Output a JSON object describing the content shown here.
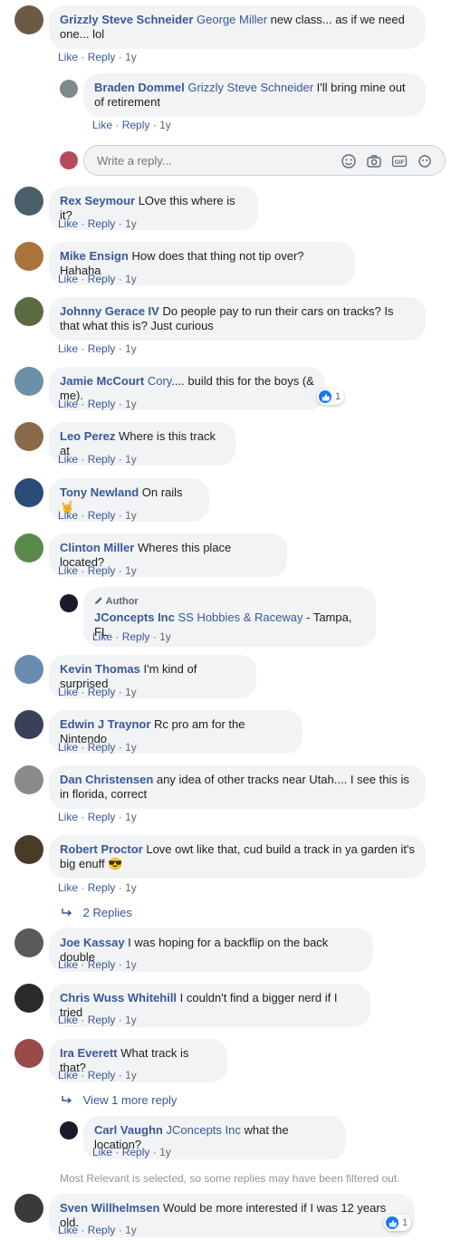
{
  "comments": [
    {
      "name": "Grizzly Steve Schneider",
      "tag": "George Miller",
      "text": " new class... as if we need one... lol",
      "meta": [
        "Like",
        "Reply",
        "1y"
      ]
    },
    {
      "name": "Braden Dommel",
      "tag": "Grizzly Steve Schneider",
      "text": " I'll bring mine out of retirement",
      "meta": [
        "Like",
        "Reply",
        "1y"
      ]
    },
    {
      "name": "Rex Seymour",
      "tag": "",
      "text": " LOve this where is it?",
      "meta": [
        "Like",
        "Reply",
        "1y"
      ]
    },
    {
      "name": "Mike Ensign",
      "tag": "",
      "text": " How does that thing not tip over? Hahaha",
      "meta": [
        "Like",
        "Reply",
        "1y"
      ]
    },
    {
      "name": "Johnny Gerace IV",
      "tag": "",
      "text": " Do people pay to run their cars on tracks? Is that what this is? Just curious",
      "meta": [
        "Like",
        "Reply",
        "1y"
      ]
    },
    {
      "name": "Jamie McCourt",
      "tag": "Cory",
      "text": ".... build this for the boys (& me).",
      "meta": [
        "Like",
        "Reply",
        "1y"
      ],
      "reactions": "1"
    },
    {
      "name": "Leo Perez",
      "tag": "",
      "text": " Where is this track at",
      "meta": [
        "Like",
        "Reply",
        "1y"
      ]
    },
    {
      "name": "Tony Newland",
      "tag": "",
      "text": " On rails 🤘",
      "meta": [
        "Like",
        "Reply",
        "1y"
      ]
    },
    {
      "name": "Clinton Miller",
      "tag": "",
      "text": " Wheres this place located?",
      "meta": [
        "Like",
        "Reply",
        "1y"
      ]
    },
    {
      "name": "JConcepts Inc",
      "tag": "SS Hobbies & Raceway",
      "text": " - Tampa, FL",
      "meta": [
        "Like",
        "Reply",
        "1y"
      ],
      "badge": "Author"
    },
    {
      "name": "Kevin Thomas",
      "tag": "",
      "text": " I'm kind of surprised",
      "meta": [
        "Like",
        "Reply",
        "1y"
      ]
    },
    {
      "name": "Edwin J Traynor",
      "tag": "",
      "text": " Rc pro am for the Nintendo",
      "meta": [
        "Like",
        "Reply",
        "1y"
      ]
    },
    {
      "name": "Dan Christensen",
      "tag": "",
      "text": " any idea of other tracks near Utah.... I see this is in florida, correct",
      "meta": [
        "Like",
        "Reply",
        "1y"
      ]
    },
    {
      "name": "Robert Proctor",
      "tag": "",
      "text": " Love owt like that, cud build a track in ya garden it's big enuff 😎",
      "meta": [
        "Like",
        "Reply",
        "1y"
      ]
    },
    {
      "name": "Joe Kassay",
      "tag": "",
      "text": " I was hoping for a backflip on the back double",
      "meta": [
        "Like",
        "Reply",
        "1y"
      ]
    },
    {
      "name": "Chris Wuss Whitehill",
      "tag": "",
      "text": " I couldn't find a bigger nerd if I tried",
      "meta": [
        "Like",
        "Reply",
        "1y"
      ]
    },
    {
      "name": "Ira Everett",
      "tag": "",
      "text": " What track is that?",
      "meta": [
        "Like",
        "Reply",
        "1y"
      ]
    },
    {
      "name": "Carl Vaughn",
      "tag": "JConcepts Inc",
      "text": " what the location?",
      "meta": [
        "Like",
        "Reply",
        "1y"
      ]
    },
    {
      "name": "Sven Willhelmsen",
      "tag": "",
      "text": " Would be more interested if I was 12 years old.",
      "meta": [
        "Like",
        "Reply",
        "1y"
      ],
      "reactions": "1"
    }
  ],
  "reply_input": {
    "placeholder": "Write a reply..."
  },
  "replies_links": {
    "two_replies": "2 Replies",
    "more_reply": "View 1 more reply"
  },
  "filter_note": "Most Relevant is selected, so some replies may have been filtered out.",
  "colors": {
    "link": "#385898",
    "bubble": "#f2f3f5",
    "meta": "#606770",
    "like": "#1877f2"
  }
}
